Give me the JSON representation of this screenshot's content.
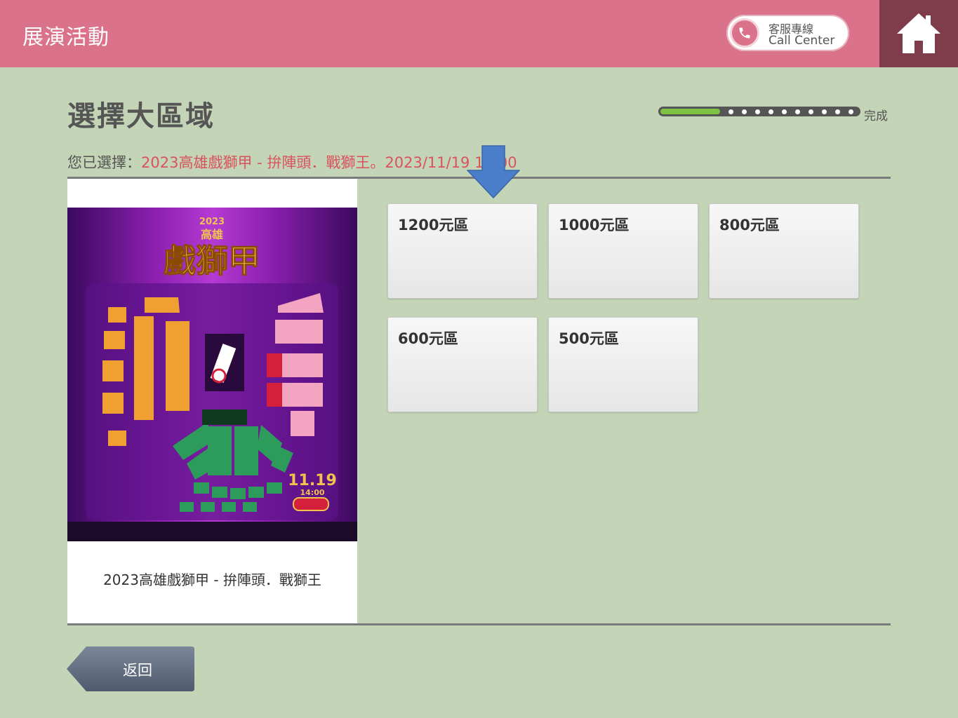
{
  "header": {
    "title": "展演活動",
    "call_center_zh": "客服專線",
    "call_center_en": "Call Center",
    "bg_color": "#d9728a",
    "home_bg_color": "#7f3d4b"
  },
  "page": {
    "title": "選擇大區域",
    "progress_label": "完成",
    "progress_fraction": 0.3
  },
  "selection": {
    "label": "您已選擇：",
    "value": "2023高雄戲獅甲 - 拚陣頭．戰獅王。2023/11/19 14:00"
  },
  "event": {
    "name": "2023高雄戲獅甲 - 拚陣頭．戰獅王",
    "poster": {
      "year": "2023",
      "city": "高雄",
      "title": "戲獅甲",
      "date": "11.19",
      "time": "14:00"
    }
  },
  "zones": [
    {
      "label": "1200元區"
    },
    {
      "label": "1000元區"
    },
    {
      "label": "800元區"
    },
    {
      "label": "600元區"
    },
    {
      "label": "500元區"
    }
  ],
  "footer": {
    "back_label": "返回"
  },
  "icons": {
    "phone": "phone-icon",
    "home": "home-icon",
    "arrow": "arrow-down-icon"
  }
}
